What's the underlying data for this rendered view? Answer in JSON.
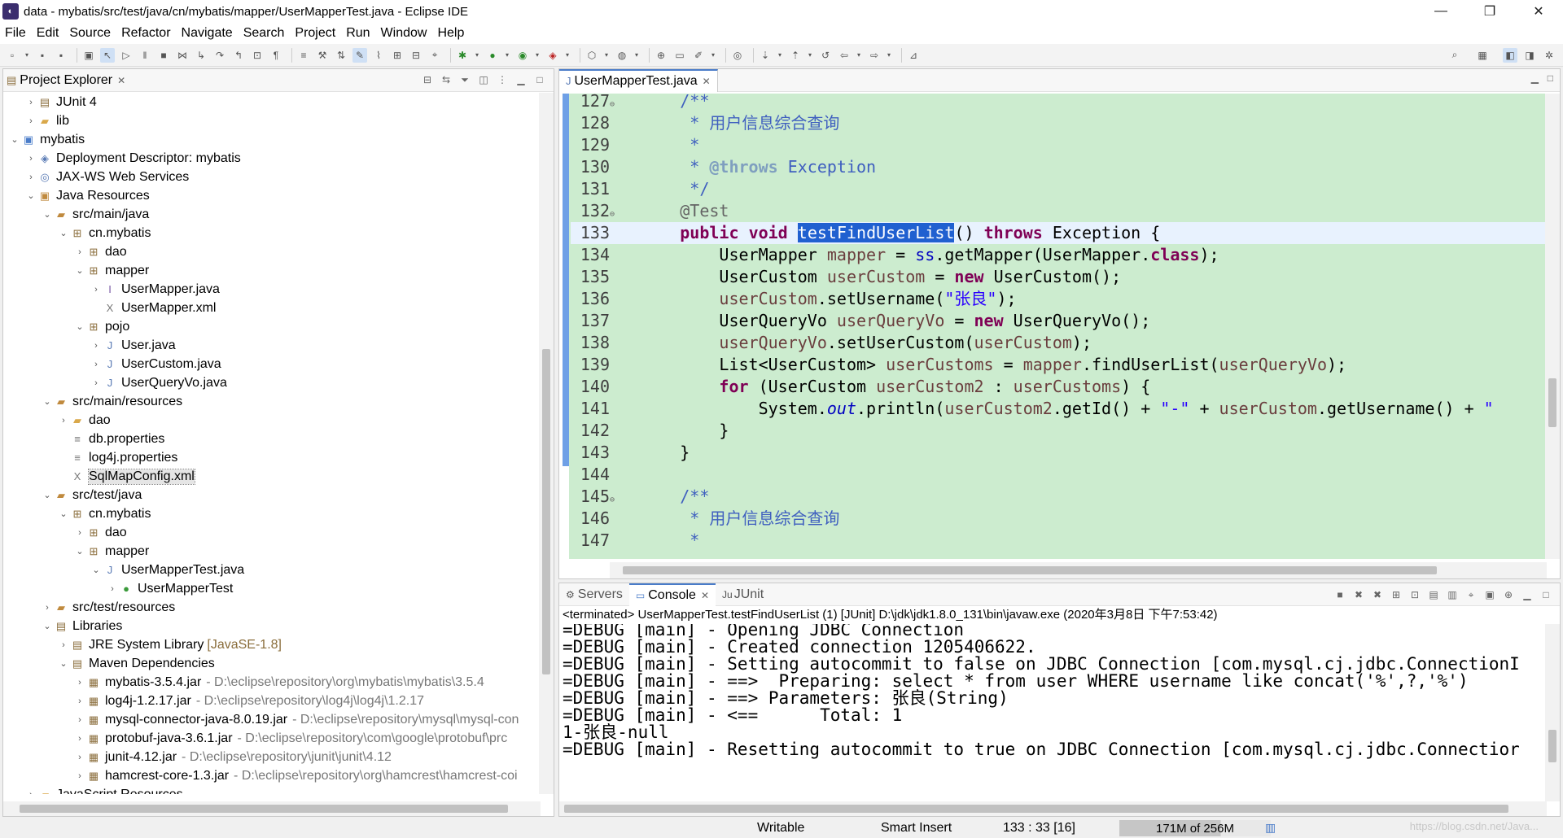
{
  "window": {
    "title": "data - mybatis/src/test/java/cn/mybatis/mapper/UserMapperTest.java - Eclipse IDE"
  },
  "menu": [
    "File",
    "Edit",
    "Source",
    "Refactor",
    "Navigate",
    "Search",
    "Project",
    "Run",
    "Window",
    "Help"
  ],
  "explorer": {
    "title": "Project Explorer",
    "rows": [
      {
        "indent": 1,
        "tw": ">",
        "icon": "library-icon",
        "label": "JUnit 4"
      },
      {
        "indent": 1,
        "tw": ">",
        "icon": "folder-icon",
        "label": "lib"
      },
      {
        "indent": 0,
        "tw": "v",
        "icon": "project-icon",
        "label": "mybatis"
      },
      {
        "indent": 1,
        "tw": ">",
        "icon": "descriptor-icon",
        "label": "Deployment Descriptor: mybatis"
      },
      {
        "indent": 1,
        "tw": ">",
        "icon": "webservice-icon",
        "label": "JAX-WS Web Services"
      },
      {
        "indent": 1,
        "tw": "v",
        "icon": "java-resources-icon",
        "label": "Java Resources"
      },
      {
        "indent": 2,
        "tw": "v",
        "icon": "source-folder-icon",
        "label": "src/main/java"
      },
      {
        "indent": 3,
        "tw": "v",
        "icon": "package-icon",
        "label": "cn.mybatis"
      },
      {
        "indent": 4,
        "tw": ">",
        "icon": "package-icon",
        "label": "dao"
      },
      {
        "indent": 4,
        "tw": "v",
        "icon": "package-icon",
        "label": "mapper"
      },
      {
        "indent": 5,
        "tw": ">",
        "icon": "java-interface-icon",
        "label": "UserMapper.java"
      },
      {
        "indent": 5,
        "tw": "",
        "icon": "xml-file-icon",
        "label": "UserMapper.xml"
      },
      {
        "indent": 4,
        "tw": "v",
        "icon": "package-icon",
        "label": "pojo"
      },
      {
        "indent": 5,
        "tw": ">",
        "icon": "java-file-icon",
        "label": "User.java"
      },
      {
        "indent": 5,
        "tw": ">",
        "icon": "java-file-icon",
        "label": "UserCustom.java"
      },
      {
        "indent": 5,
        "tw": ">",
        "icon": "java-file-icon",
        "label": "UserQueryVo.java"
      },
      {
        "indent": 2,
        "tw": "v",
        "icon": "source-folder-icon",
        "label": "src/main/resources"
      },
      {
        "indent": 3,
        "tw": ">",
        "icon": "folder-icon",
        "label": "dao"
      },
      {
        "indent": 3,
        "tw": "",
        "icon": "properties-file-icon",
        "label": "db.properties"
      },
      {
        "indent": 3,
        "tw": "",
        "icon": "properties-file-icon",
        "label": "log4j.properties"
      },
      {
        "indent": 3,
        "tw": "",
        "icon": "xml-file-icon",
        "label": "SqlMapConfig.xml",
        "selected": true
      },
      {
        "indent": 2,
        "tw": "v",
        "icon": "source-folder-icon",
        "label": "src/test/java"
      },
      {
        "indent": 3,
        "tw": "v",
        "icon": "package-icon",
        "label": "cn.mybatis"
      },
      {
        "indent": 4,
        "tw": ">",
        "icon": "package-icon",
        "label": "dao"
      },
      {
        "indent": 4,
        "tw": "v",
        "icon": "package-icon",
        "label": "mapper"
      },
      {
        "indent": 5,
        "tw": "v",
        "icon": "java-file-icon",
        "label": "UserMapperTest.java"
      },
      {
        "indent": 6,
        "tw": ">",
        "icon": "class-icon",
        "label": "UserMapperTest"
      },
      {
        "indent": 2,
        "tw": ">",
        "icon": "source-folder-icon",
        "label": "src/test/resources"
      },
      {
        "indent": 2,
        "tw": "v",
        "icon": "library-icon",
        "label": "Libraries"
      },
      {
        "indent": 3,
        "tw": ">",
        "icon": "library-icon",
        "label": "JRE System Library",
        "sub": "[JavaSE-1.8]"
      },
      {
        "indent": 3,
        "tw": "v",
        "icon": "library-icon",
        "label": "Maven Dependencies"
      },
      {
        "indent": 4,
        "tw": ">",
        "icon": "jar-icon",
        "label": "mybatis-3.5.4.jar",
        "path": "- D:\\eclipse\\repository\\org\\mybatis\\mybatis\\3.5.4"
      },
      {
        "indent": 4,
        "tw": ">",
        "icon": "jar-icon",
        "label": "log4j-1.2.17.jar",
        "path": "- D:\\eclipse\\repository\\log4j\\log4j\\1.2.17"
      },
      {
        "indent": 4,
        "tw": ">",
        "icon": "jar-icon",
        "label": "mysql-connector-java-8.0.19.jar",
        "path": "- D:\\eclipse\\repository\\mysql\\mysql-con"
      },
      {
        "indent": 4,
        "tw": ">",
        "icon": "jar-icon",
        "label": "protobuf-java-3.6.1.jar",
        "path": "- D:\\eclipse\\repository\\com\\google\\protobuf\\prc"
      },
      {
        "indent": 4,
        "tw": ">",
        "icon": "jar-icon",
        "label": "junit-4.12.jar",
        "path": "- D:\\eclipse\\repository\\junit\\junit\\4.12"
      },
      {
        "indent": 4,
        "tw": ">",
        "icon": "jar-icon",
        "label": "hamcrest-core-1.3.jar",
        "path": "- D:\\eclipse\\repository\\org\\hamcrest\\hamcrest-coi"
      },
      {
        "indent": 1,
        "tw": ">",
        "icon": "folder-icon",
        "label": "JavaScript Resources"
      }
    ]
  },
  "editor": {
    "tab": "UserMapperTest.java",
    "lines": [
      {
        "n": "127",
        "fold": "⊖",
        "html": [
          [
            "",
            "    "
          ],
          [
            "cm",
            "/**"
          ]
        ]
      },
      {
        "n": "128",
        "html": [
          [
            "cm",
            "     * 用户信息综合查询"
          ]
        ]
      },
      {
        "n": "129",
        "html": [
          [
            "cm",
            "     *"
          ]
        ]
      },
      {
        "n": "130",
        "html": [
          [
            "cm",
            "     * "
          ],
          [
            "cmtag",
            "@throws"
          ],
          [
            "cm",
            " Exception"
          ]
        ]
      },
      {
        "n": "131",
        "html": [
          [
            "cm",
            "     */"
          ]
        ]
      },
      {
        "n": "132",
        "fold": "⊖",
        "html": [
          [
            "ann",
            "    @Test"
          ]
        ]
      },
      {
        "n": "133",
        "cur": true,
        "html": [
          [
            "",
            "    "
          ],
          [
            "kw",
            "public"
          ],
          [
            "",
            " "
          ],
          [
            "kw",
            "void"
          ],
          [
            "",
            " "
          ],
          [
            "hl",
            "testFindUserList"
          ],
          [
            "",
            "() "
          ],
          [
            "kw",
            "throws"
          ],
          [
            "",
            " Exception {"
          ]
        ]
      },
      {
        "n": "134",
        "html": [
          [
            "",
            "        UserMapper "
          ],
          [
            "var",
            "mapper"
          ],
          [
            "",
            " = "
          ],
          [
            "fld",
            "ss"
          ],
          [
            "",
            ".getMapper(UserMapper."
          ],
          [
            "kw",
            "class"
          ],
          [
            "",
            ");"
          ]
        ]
      },
      {
        "n": "135",
        "html": [
          [
            "",
            "        UserCustom "
          ],
          [
            "var",
            "userCustom"
          ],
          [
            "",
            " = "
          ],
          [
            "kw",
            "new"
          ],
          [
            "",
            " UserCustom();"
          ]
        ]
      },
      {
        "n": "136",
        "html": [
          [
            "",
            "        "
          ],
          [
            "var",
            "userCustom"
          ],
          [
            "",
            ".setUsername("
          ],
          [
            "str",
            "\"张良\""
          ],
          [
            "",
            ");"
          ]
        ]
      },
      {
        "n": "137",
        "html": [
          [
            "",
            "        UserQueryVo "
          ],
          [
            "var",
            "userQueryVo"
          ],
          [
            "",
            " = "
          ],
          [
            "kw",
            "new"
          ],
          [
            "",
            " UserQueryVo();"
          ]
        ]
      },
      {
        "n": "138",
        "html": [
          [
            "",
            "        "
          ],
          [
            "var",
            "userQueryVo"
          ],
          [
            "",
            ".setUserCustom("
          ],
          [
            "var",
            "userCustom"
          ],
          [
            "",
            ");"
          ]
        ]
      },
      {
        "n": "139",
        "html": [
          [
            "",
            "        List<UserCustom> "
          ],
          [
            "var",
            "userCustoms"
          ],
          [
            "",
            " = "
          ],
          [
            "var",
            "mapper"
          ],
          [
            "",
            ".findUserList("
          ],
          [
            "var",
            "userQueryVo"
          ],
          [
            "",
            ");"
          ]
        ]
      },
      {
        "n": "140",
        "html": [
          [
            "",
            "        "
          ],
          [
            "kw",
            "for"
          ],
          [
            "",
            " (UserCustom "
          ],
          [
            "var",
            "userCustom2"
          ],
          [
            "",
            " : "
          ],
          [
            "var",
            "userCustoms"
          ],
          [
            "",
            ") {"
          ]
        ]
      },
      {
        "n": "141",
        "html": [
          [
            "",
            "            System."
          ],
          [
            "stat",
            "out"
          ],
          [
            "",
            ".println("
          ],
          [
            "var",
            "userCustom2"
          ],
          [
            "",
            ".getId() + "
          ],
          [
            "str",
            "\"-\""
          ],
          [
            "",
            " + "
          ],
          [
            "var",
            "userCustom"
          ],
          [
            "",
            ".getUsername() + "
          ],
          [
            "str",
            "\""
          ]
        ]
      },
      {
        "n": "142",
        "html": [
          [
            "",
            "        }"
          ]
        ]
      },
      {
        "n": "143",
        "html": [
          [
            "",
            "    }"
          ]
        ]
      },
      {
        "n": "144",
        "html": [
          [
            "",
            ""
          ]
        ]
      },
      {
        "n": "145",
        "fold": "⊖",
        "html": [
          [
            "",
            "    "
          ],
          [
            "cm",
            "/**"
          ]
        ]
      },
      {
        "n": "146",
        "html": [
          [
            "cm",
            "     * 用户信息综合查询"
          ]
        ]
      },
      {
        "n": "147",
        "html": [
          [
            "cm",
            "     *"
          ]
        ]
      }
    ]
  },
  "console": {
    "tabs": [
      "Servers",
      "Console",
      "JUnit"
    ],
    "terminated": "<terminated> UserMapperTest.testFindUserList (1) [JUnit] D:\\jdk\\jdk1.8.0_131\\bin\\javaw.exe (2020年3月8日 下午7:53:42)",
    "lines": [
      "=DEBUG [main] - Opening JDBC Connection",
      "=DEBUG [main] - Created connection 1205406622.",
      "=DEBUG [main] - Setting autocommit to false on JDBC Connection [com.mysql.cj.jdbc.ConnectionI",
      "=DEBUG [main] - ==>  Preparing: select * from user WHERE username like concat('%',?,'%')",
      "=DEBUG [main] - ==> Parameters: 张良(String)",
      "=DEBUG [main] - <==      Total: 1",
      "1-张良-null",
      "=DEBUG [main] - Resetting autocommit to true on JDBC Connection [com.mysql.cj.jdbc.Connectior"
    ]
  },
  "status": {
    "writable": "Writable",
    "insert": "Smart Insert",
    "position": "133 : 33 [16]",
    "heap": "171M of 256M",
    "heap_used_fraction": 0.67,
    "watermark": "https://blog.csdn.net/Java..."
  }
}
